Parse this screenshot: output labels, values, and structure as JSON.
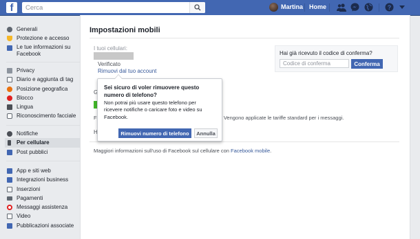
{
  "topbar": {
    "logo": "f",
    "search_placeholder": "Cerca",
    "user_name": "Martina",
    "home_label": "Home"
  },
  "sidebar": {
    "groups": [
      [
        {
          "label": "Generali",
          "icon": "gear-icon",
          "color": "#606770"
        },
        {
          "label": "Protezione e accesso",
          "icon": "shield-icon",
          "color": "#f5b728"
        },
        {
          "label": "Le tue informazioni su Facebook",
          "icon": "facebook-icon",
          "color": "#4267b2"
        }
      ],
      [
        {
          "label": "Privacy",
          "icon": "lock-icon",
          "color": "#8d949e"
        },
        {
          "label": "Diario e aggiunta di tag",
          "icon": "timeline-icon",
          "color": "#606770"
        },
        {
          "label": "Posizione geografica",
          "icon": "location-icon",
          "color": "#e9710f"
        },
        {
          "label": "Blocco",
          "icon": "block-icon",
          "color": "#e02020"
        },
        {
          "label": "Lingua",
          "icon": "language-icon",
          "color": "#4b4f56"
        },
        {
          "label": "Riconoscimento facciale",
          "icon": "face-icon",
          "color": "#606770"
        }
      ],
      [
        {
          "label": "Notifiche",
          "icon": "globe-icon",
          "color": "#4b4f56"
        },
        {
          "label": "Per cellulare",
          "icon": "mobile-icon",
          "color": "#4b4f56",
          "active": true
        },
        {
          "label": "Post pubblici",
          "icon": "rss-icon",
          "color": "#4267b2"
        }
      ],
      [
        {
          "label": "App e siti web",
          "icon": "apps-icon",
          "color": "#4267b2"
        },
        {
          "label": "Integrazioni business",
          "icon": "business-icon",
          "color": "#4267b2"
        },
        {
          "label": "Inserzioni",
          "icon": "ads-icon",
          "color": "#606770"
        },
        {
          "label": "Pagamenti",
          "icon": "payments-icon",
          "color": "#606770"
        },
        {
          "label": "Messaggi assistenza",
          "icon": "support-icon",
          "color": "#e02020"
        },
        {
          "label": "Video",
          "icon": "video-icon",
          "color": "#606770"
        },
        {
          "label": "Pubblicazioni associate",
          "icon": "publications-icon",
          "color": "#4267b2"
        }
      ]
    ]
  },
  "main": {
    "title": "Impostazioni mobili",
    "cell_label": "I tuoi cellulari:",
    "verified": "Verificato",
    "remove_link": "Rimuovi dal tuo account",
    "partial_g": "G",
    "partial_f": "Fi",
    "partial_h": "H",
    "fee_text": "i. Vengono applicate le tariffe standard per i messaggi.",
    "code_box": {
      "label": "Hai già ricevuto il codice di conferma?",
      "placeholder": "Codice di conferma",
      "button": "Conferma"
    },
    "more_info_prefix": "Maggiori informazioni sull'uso di Facebook sul cellulare con ",
    "more_info_link": "Facebook mobile",
    "more_info_suffix": "."
  },
  "popover": {
    "title": "Sei sicuro di voler rimuovere questo numero di telefono?",
    "body": "Non potrai più usare questo telefono per ricevere notifiche o caricare foto e video su Facebook.",
    "primary_button": "Rimuovi numero di telefono",
    "cancel_button": "Annulla"
  },
  "colors": {
    "brand_blue": "#4267b2",
    "link": "#365899",
    "background": "#e9ebee"
  }
}
